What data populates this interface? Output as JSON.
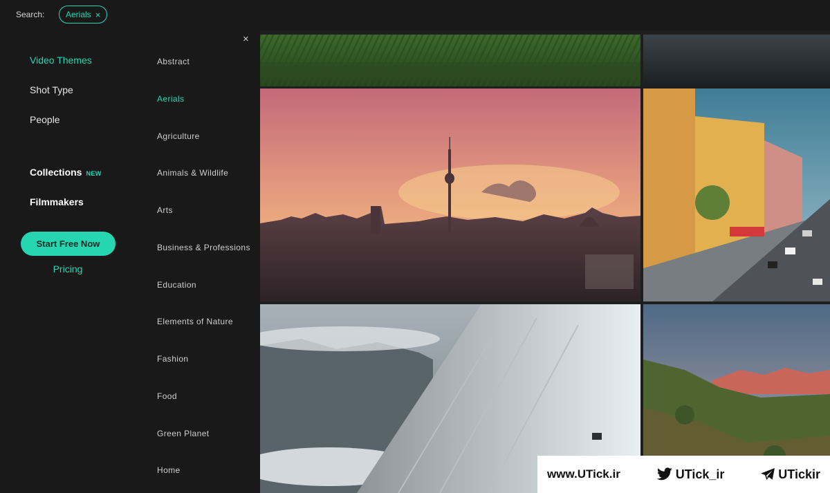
{
  "search": {
    "label": "Search:",
    "chip_label": "Aerials",
    "chip_remove": "×"
  },
  "nav": {
    "items": [
      {
        "label": "Video Themes"
      },
      {
        "label": "Shot Type"
      },
      {
        "label": "People"
      }
    ],
    "collections_label": "Collections",
    "collections_badge": "NEW",
    "filmmakers_label": "Filmmakers",
    "cta_label": "Start Free Now",
    "pricing_label": "Pricing"
  },
  "themes": {
    "close_label": "×",
    "items": [
      {
        "label": "Abstract"
      },
      {
        "label": "Aerials"
      },
      {
        "label": "Agriculture"
      },
      {
        "label": "Animals & Wildlife"
      },
      {
        "label": "Arts"
      },
      {
        "label": "Business & Professions"
      },
      {
        "label": "Education"
      },
      {
        "label": "Elements of Nature"
      },
      {
        "label": "Fashion"
      },
      {
        "label": "Food"
      },
      {
        "label": "Green Planet"
      },
      {
        "label": "Home"
      }
    ],
    "active_index": 1
  },
  "watermark": {
    "site_prefix": "www.",
    "site_brand": "UTick",
    "site_suffix": ".ir",
    "twitter": "UTick_ir",
    "telegram": "UTickir"
  },
  "colors": {
    "accent": "#25d6b1",
    "background": "#191919"
  }
}
